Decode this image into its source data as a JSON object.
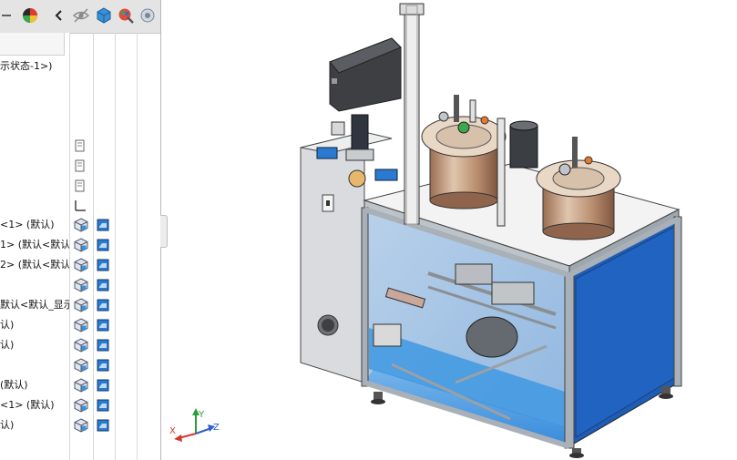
{
  "toolbar": {
    "icons": [
      "collapse-arrow-icon",
      "appearance-pie-icon",
      "chevron-left-icon",
      "hide-show-eye-icon",
      "part-cube-icon",
      "appearance-brush-icon",
      "display-state-icon"
    ]
  },
  "tree": {
    "header_text": "示状态-1>)",
    "rows": [
      {
        "label": "<1> (默认)"
      },
      {
        "label": "1> (默认<默认"
      },
      {
        "label": "2> (默认<默认"
      },
      {
        "label": ""
      },
      {
        "label": "默认<默认_显示"
      },
      {
        "label": "认)"
      },
      {
        "label": "认)"
      },
      {
        "label": ""
      },
      {
        "label": "(默认)"
      },
      {
        "label": "<1> (默认)"
      },
      {
        "label": "认)"
      }
    ]
  },
  "triad": {
    "x_label": "X",
    "y_label": "Y",
    "z_label": "Z"
  },
  "colors": {
    "frame": "#a9b0b8",
    "blue_panel": "#1e5db8",
    "glass": "#a7c6e6",
    "cabinet": "#d8dade",
    "tank": "#c29a7c"
  }
}
